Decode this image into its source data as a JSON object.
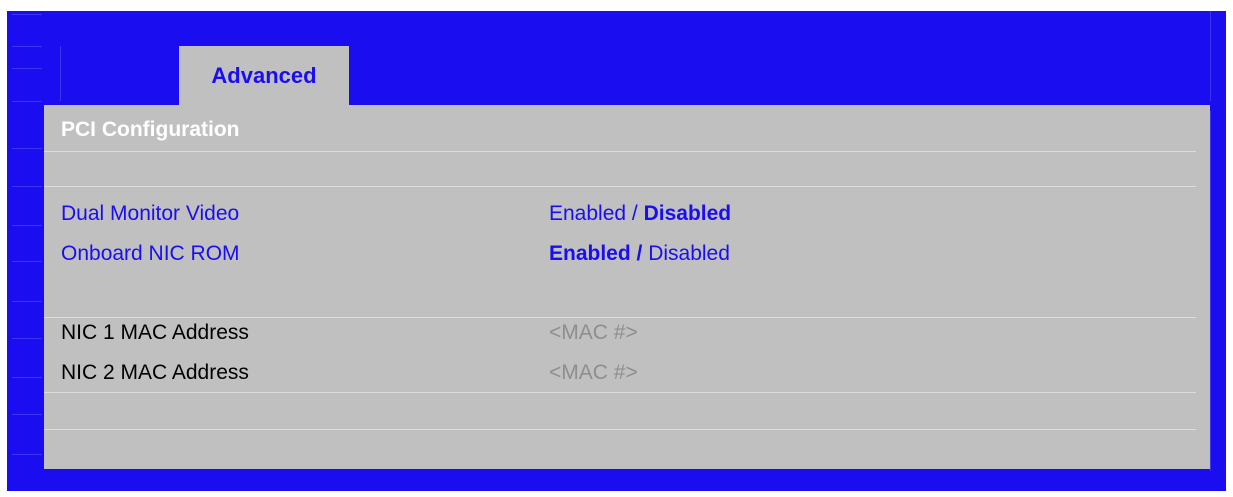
{
  "tabs": [
    {
      "label": "Advanced"
    }
  ],
  "panel": {
    "title": "PCI Configuration"
  },
  "settings": [
    {
      "label": "Dual Monitor Video",
      "options": [
        "Enabled",
        "Disabled"
      ],
      "selected": "Disabled",
      "separator": " / "
    },
    {
      "label": "Onboard NIC ROM",
      "options": [
        "Enabled",
        "Disabled"
      ],
      "selected": "Enabled",
      "separator": " / "
    }
  ],
  "info": [
    {
      "label": "NIC 1 MAC Address",
      "value": "<MAC #>"
    },
    {
      "label": "NIC 2 MAC Address",
      "value": "<MAC #>"
    }
  ],
  "colors": {
    "background": "#1a0ef0",
    "panel": "#c0c0c0",
    "accent_text": "#1a0ef0",
    "readonly_value": "#8e8e8e",
    "title_text": "#ffffff"
  }
}
